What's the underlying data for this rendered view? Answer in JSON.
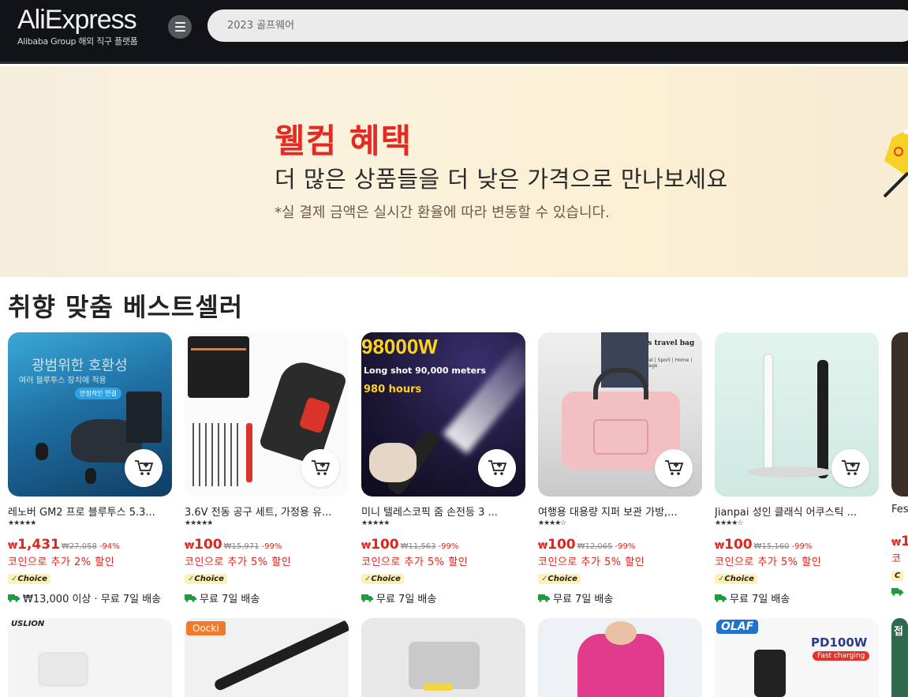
{
  "header": {
    "logo_text": "AliExpress",
    "logo_subtitle": "Alibaba Group 해외 직구 플랫폼",
    "search_placeholder": "2023 골프웨어"
  },
  "banner": {
    "title": "웰컴 혜택",
    "subtitle": "더 많은 상품들을 더 낮은 가격으로 만나보세요",
    "note": "*실 결제 금액은 실시간 환율에 따라 변동할 수 있습니다."
  },
  "section": {
    "title": "취향 맞춤 베스트셀러"
  },
  "products": [
    {
      "title": "레노버 GM2 프로 블루투스 5.3...",
      "currency": "₩",
      "price": "1,431",
      "old_price": "₩27,058",
      "discount": "-94%",
      "coin": "코인으로 추가 2% 할인",
      "badge": "Choice",
      "shipping": "₩13,000 이상 · 무료 7일 배송",
      "image_text_1": "광범위한 호환성",
      "image_text_2": "여러 블루투스 장치에 적용",
      "image_text_3": "안정적인 연결"
    },
    {
      "title": "3.6V 전동 공구 세트, 가정용 유...",
      "currency": "₩",
      "price": "100",
      "old_price": "₩15,971",
      "discount": "-99%",
      "coin": "코인으로 추가 5% 할인",
      "badge": "Choice",
      "shipping": "무료 7일 배송"
    },
    {
      "title": "미니 텔레스코픽 줌 손전등 3 ...",
      "currency": "₩",
      "price": "100",
      "old_price": "₩11,563",
      "discount": "-99%",
      "coin": "코인으로 추가 5% 할인",
      "badge": "Choice",
      "shipping": "무료 7일 배송",
      "image_text_1": "98000W",
      "image_text_2": "Long shot 90,000 meters",
      "image_text_3": "980 hours"
    },
    {
      "title": "여행용 대용량 지퍼 보관 가방,...",
      "currency": "₩",
      "price": "100",
      "old_price": "₩12,065",
      "discount": "-99%",
      "coin": "코인으로 추가 5% 할인",
      "badge": "Choice",
      "shipping": "무료 7일 배송",
      "image_text_1": "Fitness travel bag",
      "image_text_2": "Travel | Sport | Home | Storage"
    },
    {
      "title": "Jianpai 성인 클래식 어쿠스틱 ...",
      "currency": "₩",
      "price": "100",
      "old_price": "₩15,160",
      "discount": "-99%",
      "coin": "코인으로 추가 5% 할인",
      "badge": "Choice",
      "shipping": "무료 7일 배송"
    },
    {
      "title": "Fes",
      "currency": "₩",
      "price": "1",
      "coin": "코",
      "badge": "C"
    }
  ],
  "second_row": {
    "brand_1": "USLION",
    "brand_2": "Oocki",
    "brand_5": "OLAF",
    "pd_label": "PD100W",
    "fast_label": "Fast charging",
    "cut_label": "접"
  },
  "colors": {
    "accent": "#e0241b",
    "header_bg": "#111317",
    "banner_bg": "#fbf2dc",
    "choice_bg": "#fdf1b8"
  }
}
